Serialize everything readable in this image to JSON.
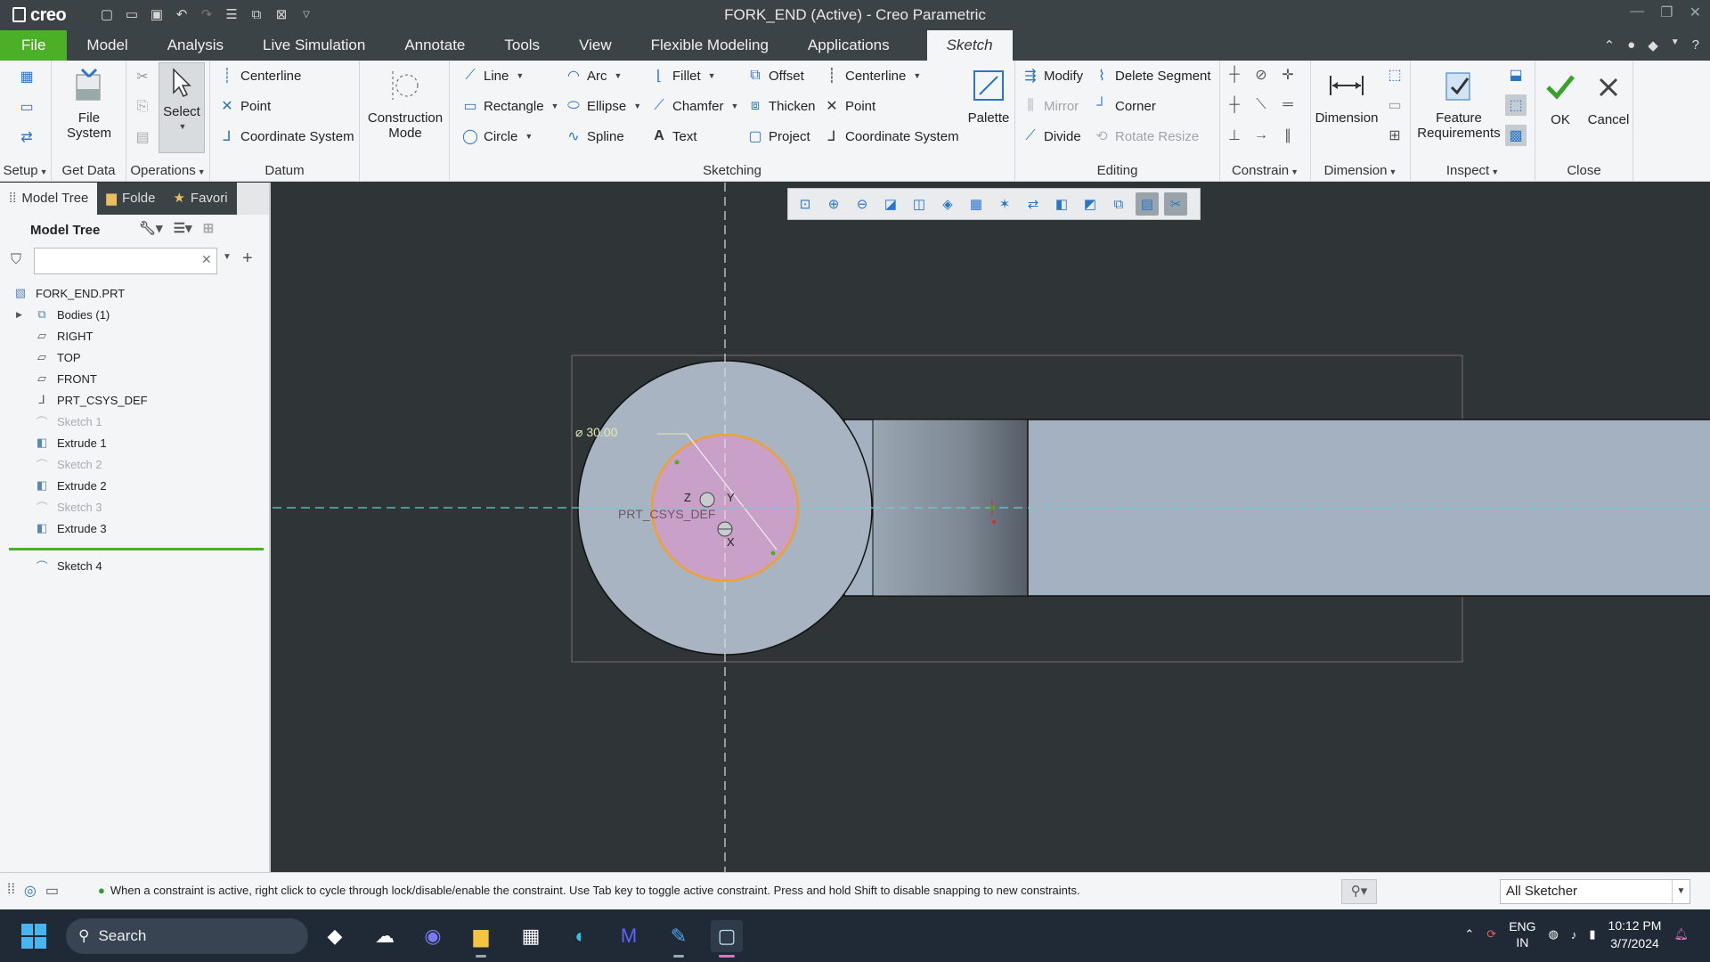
{
  "titlebar": {
    "logo": "creo",
    "title": "FORK_END (Active) - Creo Parametric"
  },
  "tabs": [
    "File",
    "Model",
    "Analysis",
    "Live Simulation",
    "Annotate",
    "Tools",
    "View",
    "Flexible Modeling",
    "Applications",
    "Sketch"
  ],
  "ribbon": {
    "setup": "Setup",
    "get_data": "Get Data",
    "file_system": "File\nSystem",
    "file_system_l1": "File",
    "file_system_l2": "System",
    "operations": "Operations",
    "select": "Select",
    "datum": {
      "label": "Datum",
      "centerline": "Centerline",
      "point": "Point",
      "coordinate_system": "Coordinate System"
    },
    "construction_mode_l1": "Construction",
    "construction_mode_l2": "Mode",
    "sketching": {
      "label": "Sketching",
      "line": "Line",
      "rectangle": "Rectangle",
      "circle": "Circle",
      "arc": "Arc",
      "ellipse": "Ellipse",
      "spline": "Spline",
      "fillet": "Fillet",
      "chamfer": "Chamfer",
      "text": "Text",
      "offset": "Offset",
      "thicken": "Thicken",
      "project": "Project",
      "centerline": "Centerline",
      "point": "Point",
      "coordinate_system": "Coordinate System",
      "palette": "Palette"
    },
    "editing": {
      "label": "Editing",
      "modify": "Modify",
      "mirror": "Mirror",
      "divide": "Divide",
      "delete_segment": "Delete Segment",
      "corner": "Corner",
      "rotate_resize": "Rotate Resize"
    },
    "constrain": "Constrain",
    "dimension_btn": "Dimension",
    "dimension": "Dimension",
    "feature_requirements_l1": "Feature",
    "feature_requirements_l2": "Requirements",
    "inspect": "Inspect",
    "ok": "OK",
    "cancel": "Cancel",
    "close": "Close"
  },
  "leftpanel": {
    "tabs": [
      "Model Tree",
      "Folde",
      "Favori"
    ],
    "header": "Model Tree",
    "filter_placeholder": "",
    "items": [
      {
        "label": "FORK_END.PRT",
        "icon": "part-icon",
        "dim": false
      },
      {
        "label": "Bodies (1)",
        "icon": "bodies-icon",
        "dim": false
      },
      {
        "label": "RIGHT",
        "icon": "datum-plane-icon",
        "dim": false
      },
      {
        "label": "TOP",
        "icon": "datum-plane-icon",
        "dim": false
      },
      {
        "label": "FRONT",
        "icon": "datum-plane-icon",
        "dim": false
      },
      {
        "label": "PRT_CSYS_DEF",
        "icon": "csys-icon",
        "dim": false
      },
      {
        "label": "Sketch 1",
        "icon": "sketch-icon",
        "dim": true
      },
      {
        "label": "Extrude 1",
        "icon": "extrude-icon",
        "dim": false
      },
      {
        "label": "Sketch 2",
        "icon": "sketch-icon",
        "dim": true
      },
      {
        "label": "Extrude 2",
        "icon": "extrude-icon",
        "dim": false
      },
      {
        "label": "Sketch 3",
        "icon": "sketch-icon",
        "dim": true
      },
      {
        "label": "Extrude 3",
        "icon": "extrude-icon",
        "dim": false
      },
      {
        "label": "Sketch 4",
        "icon": "sketch-icon",
        "dim": false
      }
    ]
  },
  "canvas": {
    "dimension_text": "30.00",
    "csys_label": "PRT_CSYS_DEF",
    "axis_z": "Z",
    "axis_y": "Y",
    "axis_x": "X"
  },
  "status": {
    "message": "When a constraint is active, right click to cycle through lock/disable/enable the constraint. Use Tab key to toggle active constraint. Press and hold Shift to disable snapping to new constraints.",
    "selection_filter": "All Sketcher"
  },
  "taskbar": {
    "search": "Search",
    "lang_1": "ENG",
    "lang_2": "IN",
    "time": "10:12 PM",
    "date": "3/7/2024"
  },
  "colors": {
    "file_tab": "#4caf28",
    "accent_blue": "#2a75c8",
    "canvas_bg": "#2f3537",
    "part_fill": "#a3b1c0",
    "selected_circle": "#c8a0c8",
    "selected_outline": "#f0a030"
  }
}
